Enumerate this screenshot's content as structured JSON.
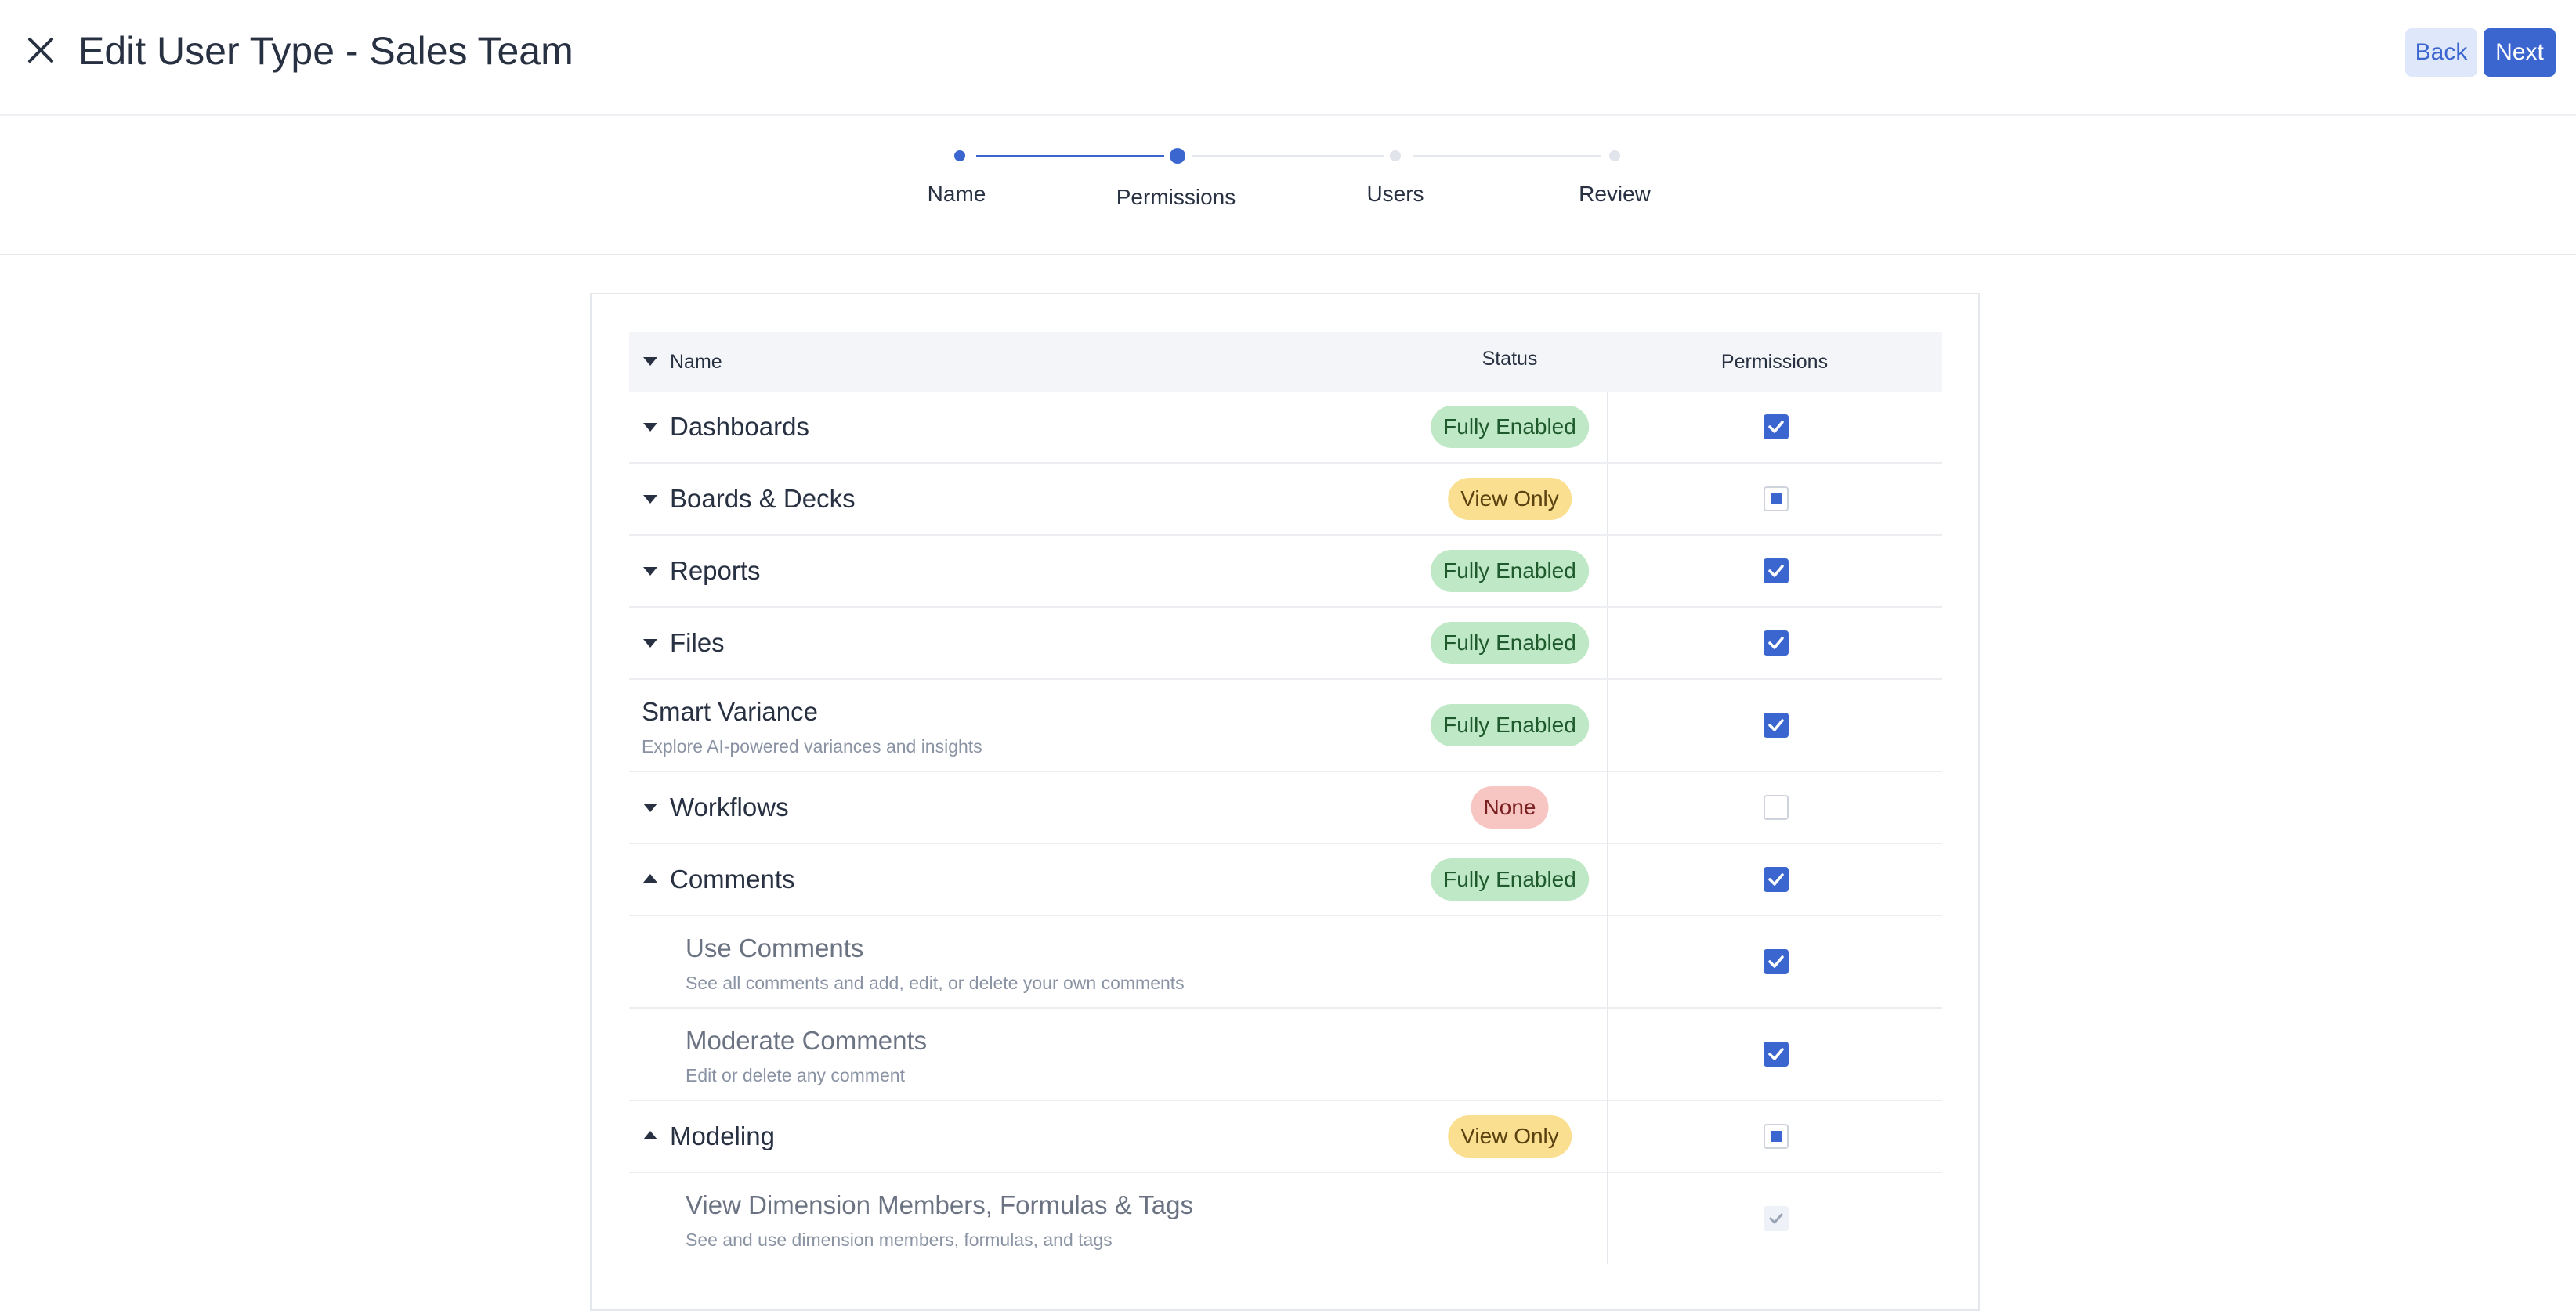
{
  "header": {
    "title": "Edit User Type - Sales Team",
    "back_label": "Back",
    "next_label": "Next"
  },
  "stepper": {
    "steps": [
      {
        "label": "Name",
        "state": "completed"
      },
      {
        "label": "Permissions",
        "state": "active"
      },
      {
        "label": "Users",
        "state": "pending"
      },
      {
        "label": "Review",
        "state": "pending"
      }
    ]
  },
  "colors": {
    "accent": "#3c66cf",
    "fully_enabled_bg": "#bfe8c6",
    "view_only_bg": "#fbdf91",
    "none_bg": "#f7c6c3"
  },
  "table": {
    "columns": {
      "name": "Name",
      "status": "Status",
      "permissions": "Permissions"
    },
    "rows": [
      {
        "name": "Dashboards",
        "status": "Fully Enabled",
        "permission": "checked",
        "caret": "down"
      },
      {
        "name": "Boards & Decks",
        "status": "View Only",
        "permission": "partial",
        "caret": "down"
      },
      {
        "name": "Reports",
        "status": "Fully Enabled",
        "permission": "checked",
        "caret": "down"
      },
      {
        "name": "Files",
        "status": "Fully Enabled",
        "permission": "checked",
        "caret": "down"
      },
      {
        "name": "Smart Variance",
        "description": "Explore AI-powered variances and insights",
        "status": "Fully Enabled",
        "permission": "checked"
      },
      {
        "name": "Workflows",
        "status": "None",
        "permission": "unchecked",
        "caret": "down"
      },
      {
        "name": "Comments",
        "status": "Fully Enabled",
        "permission": "checked",
        "caret": "up"
      },
      {
        "name": "Use Comments",
        "description": "See all comments and add, edit, or delete your own comments",
        "permission": "checked",
        "sub": true
      },
      {
        "name": "Moderate Comments",
        "description": "Edit or delete any comment",
        "permission": "checked",
        "sub": true
      },
      {
        "name": "Modeling",
        "status": "View Only",
        "permission": "partial",
        "caret": "up"
      },
      {
        "name": "View Dimension Members, Formulas & Tags",
        "description": "See and use dimension members, formulas, and tags",
        "permission": "checked-disabled",
        "sub": true
      }
    ]
  }
}
